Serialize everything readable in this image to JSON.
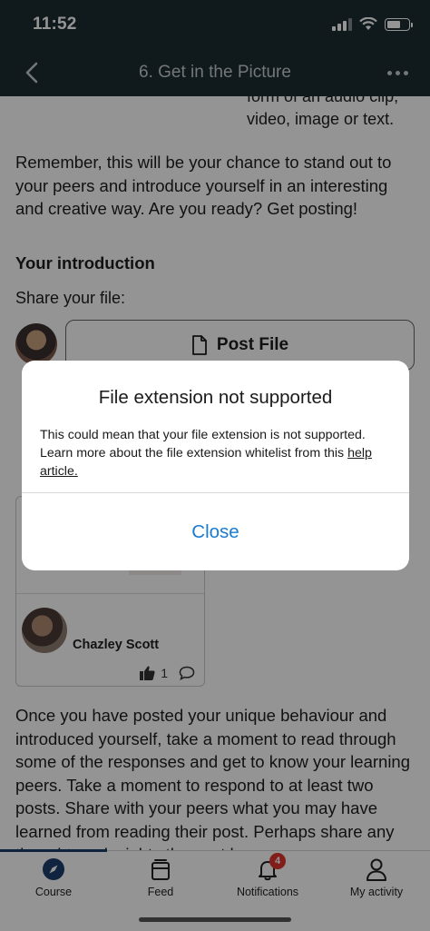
{
  "status_bar": {
    "time": "11:52"
  },
  "nav": {
    "title": "6. Get in the Picture"
  },
  "content": {
    "partial_text": "form of an audio clip, video, image or text.",
    "paragraph_1": "Remember, this will be your chance to stand out to your peers and introduce yourself in an interesting and creative way. Are you ready? Get posting!",
    "section_heading": "Your introduction",
    "share_label": "Share your file:",
    "post_file_label": "Post File",
    "card": {
      "author": "Chazley Scott",
      "like_count": "1"
    },
    "paragraph_2": "Once you have posted your unique behaviour and introduced yourself, take a moment to read through some of the responses and get to know your learning peers. Take a moment to respond to at least two posts. Share with your peers what you may have learned from reading their post. Perhaps share any thoughts or insights the post has"
  },
  "modal": {
    "title": "File extension not supported",
    "body": "This could mean that your file extension is not supported. Learn more about the file extension whitelist from this ",
    "link_text": "help article.",
    "close_label": "Close"
  },
  "tab_bar": {
    "tabs": [
      {
        "label": "Course",
        "icon": "compass-icon"
      },
      {
        "label": "Feed",
        "icon": "feed-icon"
      },
      {
        "label": "Notifications",
        "icon": "bell-icon",
        "badge": "4"
      },
      {
        "label": "My activity",
        "icon": "person-icon"
      }
    ],
    "active_color": "#1c3f6e"
  },
  "colors": {
    "header": "#1c2b30",
    "link": "#1a7bd0",
    "badge": "#e0342c"
  }
}
